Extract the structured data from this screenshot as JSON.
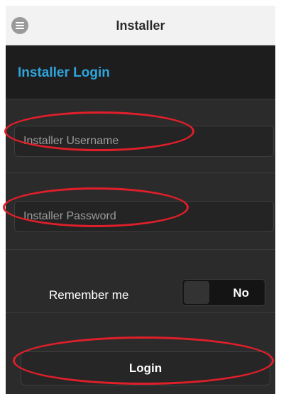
{
  "header": {
    "title": "Installer",
    "menu_icon": "menu-icon"
  },
  "section": {
    "title": "Installer Login"
  },
  "form": {
    "username_placeholder": "Installer Username",
    "username_value": "",
    "password_placeholder": "Installer Password",
    "password_value": "",
    "remember_label": "Remember me",
    "remember_toggle_value": "No",
    "login_label": "Login"
  },
  "colors": {
    "accent": "#2ea5dc",
    "annotation": "#e01f2a",
    "background": "#2b2b2b",
    "header_background": "#f2f2f2"
  }
}
